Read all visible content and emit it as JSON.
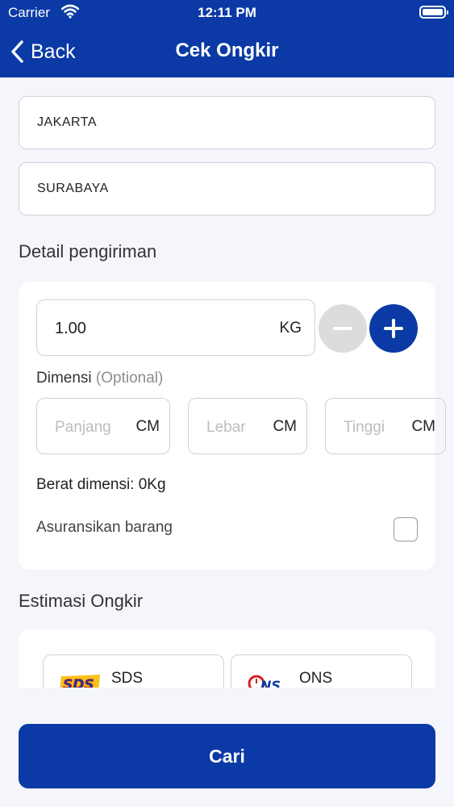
{
  "status_bar": {
    "carrier": "Carrier",
    "time": "12:11 PM"
  },
  "nav": {
    "back_label": "Back",
    "title": "Cek Ongkir"
  },
  "origin": {
    "value": "JAKARTA"
  },
  "destination": {
    "value": "SURABAYA"
  },
  "detail": {
    "title": "Detail pengiriman",
    "weight": {
      "value": "1.00",
      "unit": "KG"
    },
    "dimension_label": "Dimensi",
    "dimension_optional": "(Optional)",
    "dimensions": [
      {
        "placeholder": "Panjang",
        "unit": "CM"
      },
      {
        "placeholder": "Lebar",
        "unit": "CM"
      },
      {
        "placeholder": "Tinggi",
        "unit": "CM"
      }
    ],
    "berat_dimensi": "Berat dimensi: 0Kg",
    "insurance_label": "Asuransikan barang",
    "insurance_checked": false
  },
  "estimate": {
    "title": "Estimasi Ongkir",
    "couriers": [
      {
        "name": "SDS",
        "logo": "sds-logo"
      },
      {
        "name": "ONS",
        "logo": "ons-logo"
      }
    ]
  },
  "search_button": {
    "label": "Cari"
  },
  "colors": {
    "primary": "#0b3aa6",
    "background": "#f5f6fb",
    "border": "#cfd2d8",
    "minus_disabled": "#dcdcdc"
  }
}
